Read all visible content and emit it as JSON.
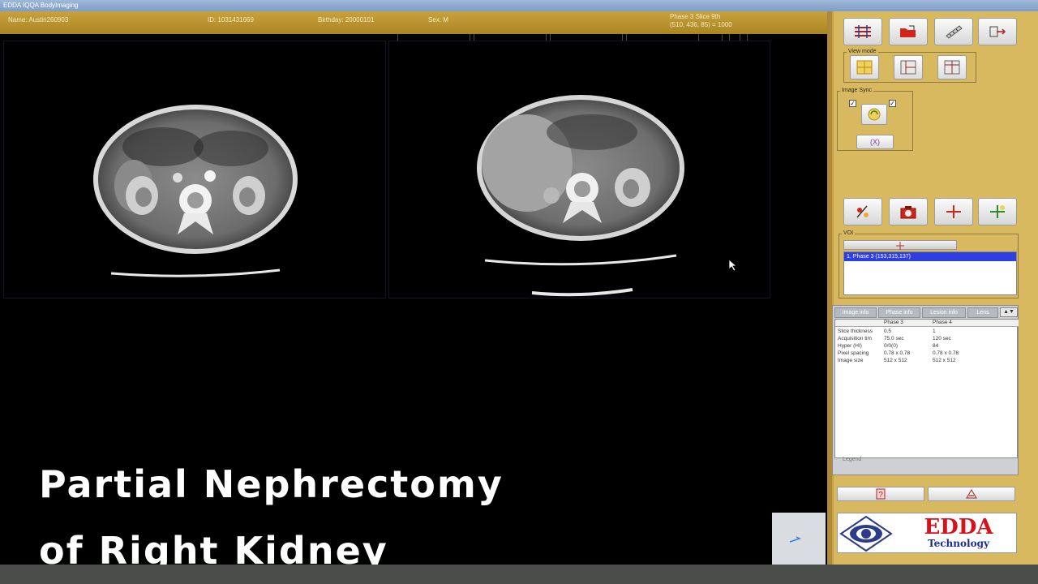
{
  "window": {
    "title": "EDDA IQQA BodyImaging"
  },
  "patient": {
    "name": "Name: Austin260903",
    "id": "ID: 1031431669",
    "birthday": "Birthday: 20000101",
    "sex": "Sex: M",
    "phase": "Phase 3  Slice 9th",
    "coords": "(510, 436, 85) = 1000"
  },
  "toolbar": {
    "top_icons": [
      "filter-icon",
      "open-folder-icon",
      "measure-icon",
      "exit-icon"
    ],
    "view_mode": {
      "label": "View mode",
      "buttons": [
        "grid-layout-icon",
        "side-layout-icon",
        "split-layout-icon"
      ]
    },
    "image_sync": {
      "label": "Image Sync",
      "sync_button": "sync-icon",
      "reset_label": "(X)"
    },
    "tool_icons": [
      "marker-icon",
      "camera-icon",
      "crosshair-icon",
      "add-marker-icon"
    ]
  },
  "voi": {
    "label": "VOI",
    "items": [
      "1. Phase 3 (153,315,137)"
    ]
  },
  "info": {
    "tabs": [
      "Image info",
      "Phase info",
      "Lesion info",
      "Lens"
    ],
    "columns": [
      "",
      "Phase 3",
      "Phase 4"
    ],
    "rows": [
      [
        "Slice thickness",
        "0.5",
        "1"
      ],
      [
        "Acquisition tim",
        "75.0 sec",
        "120 sec"
      ],
      [
        "Hyper (HI)",
        "0/0(0)",
        "84"
      ],
      [
        "Pixel spacing",
        "0.78 x 0.78",
        "0.78 x 0.78"
      ],
      [
        "Image size",
        "512 x 512",
        "512 x 512"
      ]
    ],
    "footer": "Legend"
  },
  "caption": {
    "line1": "Partial Nephrectomy",
    "line2": "of Right Kidney"
  },
  "logo": {
    "brand": "EDDA",
    "sub": "Technology"
  }
}
